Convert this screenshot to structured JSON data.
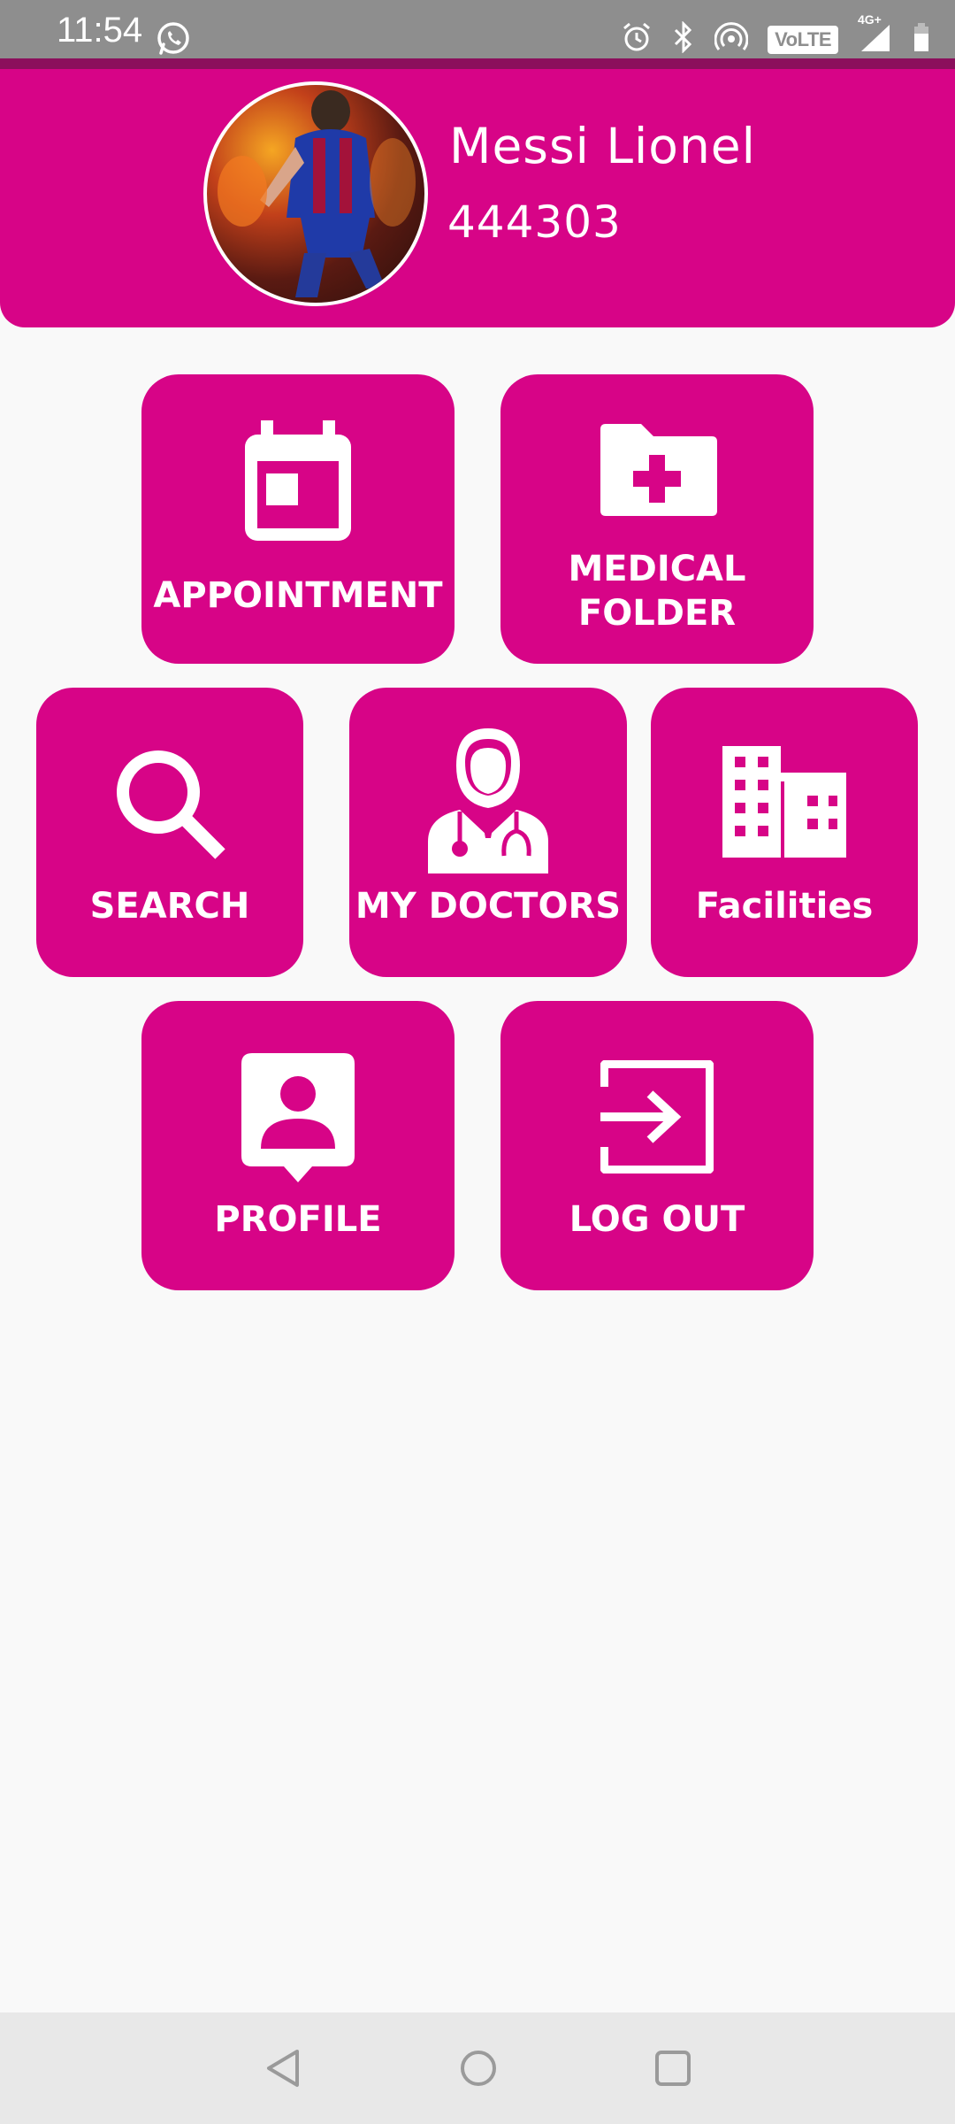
{
  "status_bar": {
    "time": "11:54",
    "volte": "VoLTE",
    "network": "4G+",
    "icons": [
      "whatsapp-icon",
      "alarm-icon",
      "bluetooth-icon",
      "hotspot-icon",
      "volte-icon",
      "signal-icon",
      "battery-icon"
    ]
  },
  "profile": {
    "name": "Messi Lionel",
    "id": "444303"
  },
  "menu": {
    "appointment": "APPOINTMENT",
    "medical_folder_line1": "MEDICAL",
    "medical_folder_line2": "FOLDER",
    "search": "SEARCH",
    "my_doctors": "MY DOCTORS",
    "facilities": "Facilities",
    "profile": "PROFILE",
    "log_out": "LOG OUT"
  },
  "colors": {
    "primary": "#d70487",
    "status_bar": "#8e8e8e",
    "accent_line": "#8b0f5c",
    "background": "#f9f9f9",
    "nav_bar": "#e8e8e8"
  },
  "nav_bar": {
    "icons": [
      "back-icon",
      "home-icon",
      "recents-icon"
    ]
  }
}
